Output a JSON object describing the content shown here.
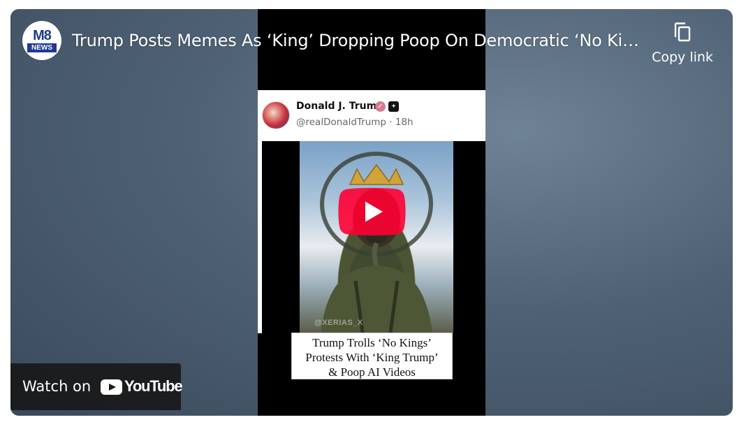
{
  "channel": {
    "logo_top": "M8",
    "logo_bottom": "NEWS"
  },
  "video": {
    "title": "Trump Posts Memes As ‘King’ Dropping Poop On Democratic ‘No Kings’ Protesters",
    "play_icon": "youtube-play-icon"
  },
  "actions": {
    "copy_link_label": "Copy link",
    "copy_icon": "copy-icon"
  },
  "tweet": {
    "name": "Donald J. Trump",
    "handle_time": "@realDonaldTrump · 18h",
    "affiliate_badge": "+",
    "watermark": "@XERIAS_X"
  },
  "caption": {
    "lines": [
      "Trump Trolls ‘No Kings’",
      "Protests With ‘King Trump’",
      "& Poop AI Videos"
    ]
  },
  "watch_on": {
    "label": "Watch on",
    "brand": "YouTube"
  },
  "colors": {
    "play_red": "#ff0033",
    "background": "#4f6275"
  }
}
